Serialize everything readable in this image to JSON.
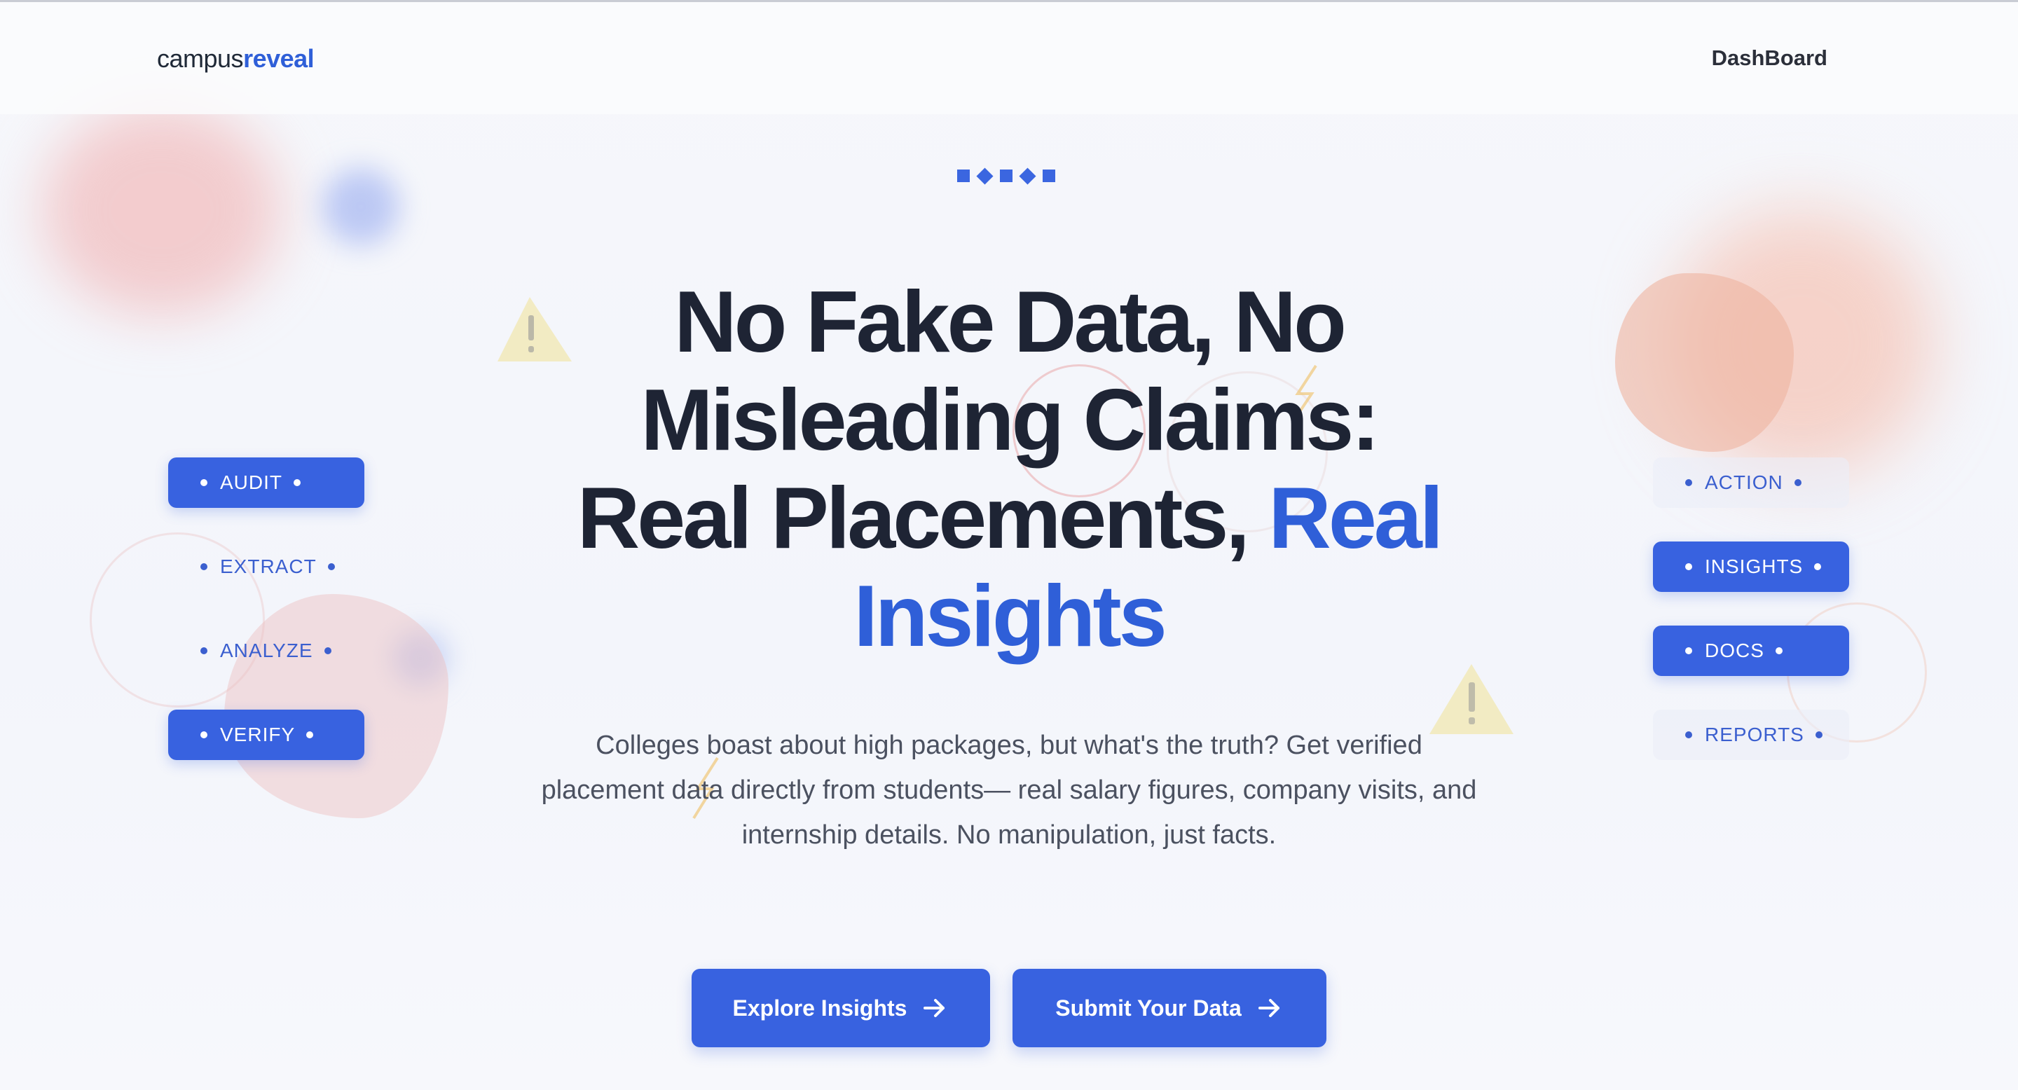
{
  "header": {
    "logo_part1": "campus",
    "logo_part2": "reveal",
    "nav_link": "DashBoard"
  },
  "hero": {
    "title_line1": "No Fake Data, No",
    "title_line2": "Misleading Claims:",
    "title_line3_plain": "Real Placements, ",
    "title_line3_accent": "Real",
    "title_line4_accent": "Insights",
    "subtitle": "Colleges boast about high packages, but what's the truth? Get verified placement data directly from students— real salary figures, company visits, and internship details. No manipulation, just facts."
  },
  "left_pills": [
    {
      "label": "AUDIT"
    },
    {
      "label": "EXTRACT"
    },
    {
      "label": "ANALYZE"
    },
    {
      "label": "VERIFY"
    }
  ],
  "right_pills": [
    {
      "label": "ACTION"
    },
    {
      "label": "INSIGHTS"
    },
    {
      "label": "DOCS"
    },
    {
      "label": "REPORTS"
    }
  ],
  "buttons": {
    "explore": "Explore Insights",
    "submit": "Submit Your Data"
  },
  "icons": {
    "arrow": "arrow-right-icon",
    "warning": "warning-icon",
    "lightning": "lightning-icon"
  },
  "colors": {
    "accent": "#2f5fd8",
    "button": "#3862e0",
    "title": "#1e2434"
  }
}
